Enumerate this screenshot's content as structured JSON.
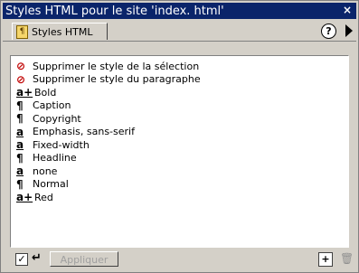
{
  "window": {
    "title": "Styles HTML pour le site 'index. html'",
    "close_glyph": "×"
  },
  "tabs": [
    {
      "label": "Styles HTML"
    }
  ],
  "toolbar": {
    "help_glyph": "?"
  },
  "styles_list": [
    {
      "icon": "remove-selection-style-icon",
      "glyph": "⊘",
      "label": "Supprimer le style de la sélection"
    },
    {
      "icon": "remove-paragraph-style-icon",
      "glyph": "⊘",
      "label": "Supprimer le style du paragraphe"
    },
    {
      "icon": "char-style-plus-icon",
      "glyph": "a+",
      "label": "Bold"
    },
    {
      "icon": "paragraph-style-icon",
      "glyph": "¶",
      "label": "Caption"
    },
    {
      "icon": "paragraph-style-icon",
      "glyph": "¶",
      "label": "Copyright"
    },
    {
      "icon": "char-style-icon",
      "glyph": "a",
      "label": "Emphasis, sans-serif"
    },
    {
      "icon": "char-style-icon",
      "glyph": "a",
      "label": "Fixed-width"
    },
    {
      "icon": "paragraph-style-icon",
      "glyph": "¶",
      "label": "Headline"
    },
    {
      "icon": "char-style-icon",
      "glyph": "a",
      "label": "none"
    },
    {
      "icon": "paragraph-style-icon",
      "glyph": "¶",
      "label": "Normal"
    },
    {
      "icon": "char-style-plus-icon",
      "glyph": "a+",
      "label": "Red"
    }
  ],
  "bottom": {
    "auto_apply_checked": true,
    "apply_label": "Appliquer"
  }
}
